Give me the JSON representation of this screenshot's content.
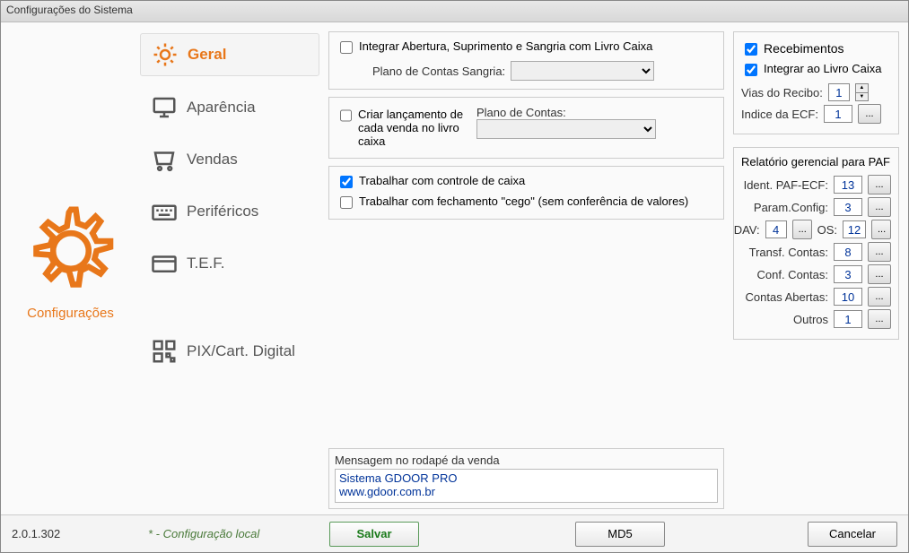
{
  "window": {
    "title": "Configurações do Sistema"
  },
  "sidebar": {
    "label": "Configurações"
  },
  "nav": {
    "items": [
      {
        "label": "Geral"
      },
      {
        "label": "Aparência"
      },
      {
        "label": "Vendas"
      },
      {
        "label": "Periféricos"
      },
      {
        "label": "T.E.F."
      },
      {
        "label": "PIX/Cart. Digital"
      }
    ]
  },
  "center": {
    "chk_integrar": "Integrar Abertura, Suprimento e Sangria com Livro Caixa",
    "plano_sangria_label": "Plano de Contas Sangria:",
    "chk_criar_lancamento": "Criar lançamento de cada venda no livro caixa",
    "plano_contas_label": "Plano de Contas:",
    "chk_controle_caixa": "Trabalhar com controle de caixa",
    "chk_fechamento_cego": "Trabalhar com fechamento \"cego\" (sem conferência de valores)",
    "footer_label": "Mensagem no rodapé da venda",
    "footer_text": "Sistema GDOOR PRO\nwww.gdoor.com.br"
  },
  "right": {
    "recebimentos": {
      "title": "Recebimentos",
      "chk_integrar_livro": "Integrar ao Livro Caixa",
      "vias_label": "Vias do Recibo:",
      "vias_value": "1",
      "indice_label": "Indice da ECF:",
      "indice_value": "1"
    },
    "relatorio": {
      "title": "Relatório gerencial para PAF",
      "ident_label": "Ident. PAF-ECF:",
      "ident_value": "13",
      "param_label": "Param.Config:",
      "param_value": "3",
      "dav_label": "DAV:",
      "dav_value": "4",
      "os_label": "OS:",
      "os_value": "12",
      "transf_label": "Transf. Contas:",
      "transf_value": "8",
      "conf_label": "Conf. Contas:",
      "conf_value": "3",
      "abertas_label": "Contas Abertas:",
      "abertas_value": "10",
      "outros_label": "Outros",
      "outros_value": "1"
    }
  },
  "bottom": {
    "version": "2.0.1.302",
    "local": "* - Configuração local",
    "salvar": "Salvar",
    "md5": "MD5",
    "cancelar": "Cancelar"
  }
}
